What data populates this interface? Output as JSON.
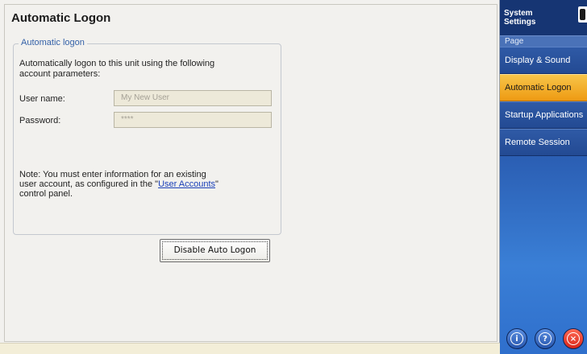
{
  "page": {
    "title": "Automatic Logon"
  },
  "groupbox": {
    "legend": "Automatic logon",
    "description_line1": "Automatically logon to this unit using the following",
    "description_line2": "account parameters:",
    "username_label": "User name:",
    "username_value": "My New User",
    "password_label": "Password:",
    "password_value": "****",
    "note_line1": "Note: You must enter information for an existing",
    "note_line2_prefix": "user account, as configured in the \"",
    "note_link": "User Accounts",
    "note_line2_suffix": "\"",
    "note_line3": "control panel.",
    "disable_button": "Disable Auto Logon"
  },
  "nav": {
    "title_line1": "System",
    "title_line2": "Settings",
    "section_label": "Page",
    "items": [
      {
        "label": "Display & Sound",
        "active": false
      },
      {
        "label": "Automatic Logon",
        "active": true
      },
      {
        "label": "Startup Applications",
        "active": false
      },
      {
        "label": "Remote Session",
        "active": false
      }
    ],
    "buttons": {
      "info_glyph": "i",
      "help_glyph": "?",
      "close_glyph": "×"
    }
  },
  "colors": {
    "accent_active": "#f0a21a",
    "nav_blue": "#2b5fb4",
    "close_red": "#d8251a",
    "legend_blue": "#3562a8"
  }
}
